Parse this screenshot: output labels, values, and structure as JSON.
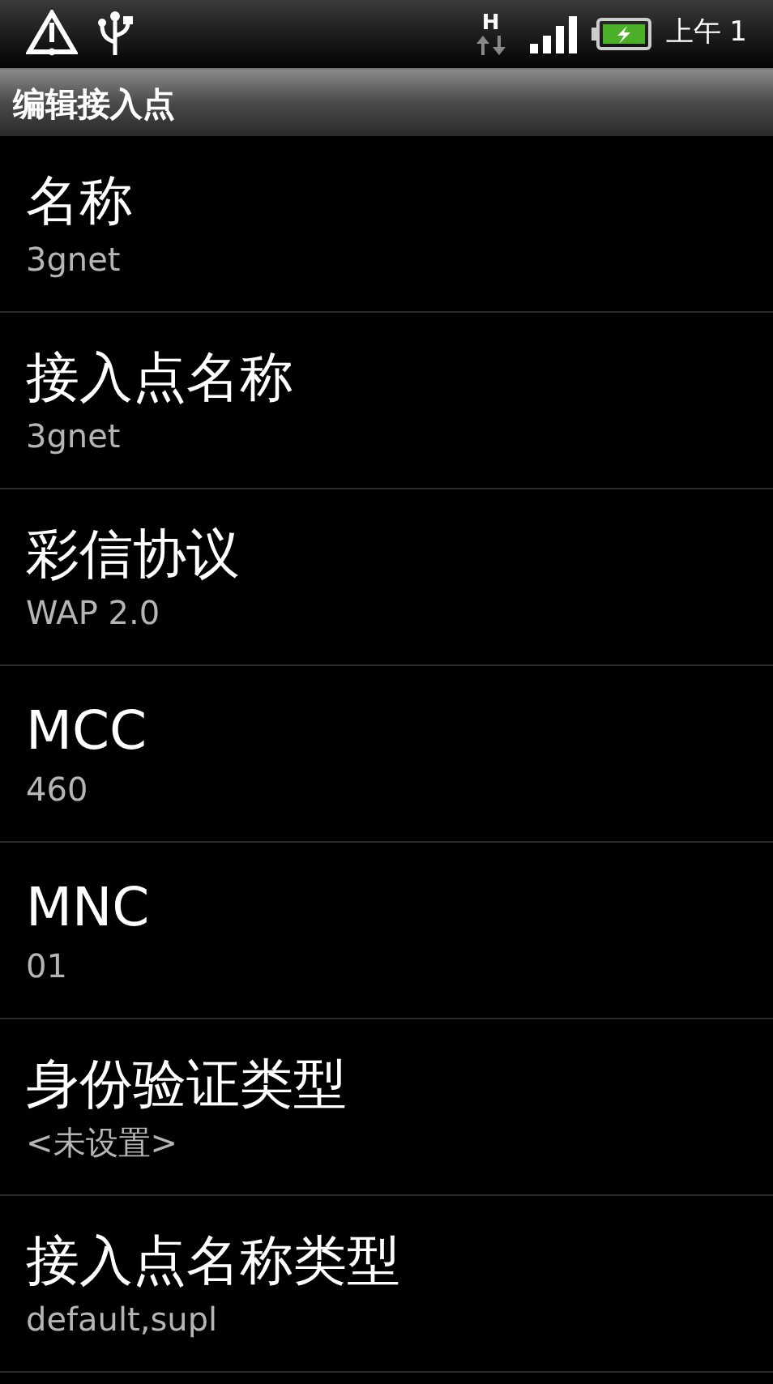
{
  "status_bar": {
    "network": "H",
    "time": "上午 1"
  },
  "title": "编辑接入点",
  "items": [
    {
      "label": "名称",
      "value": "3gnet"
    },
    {
      "label": "接入点名称",
      "value": "3gnet"
    },
    {
      "label": "彩信协议",
      "value": "WAP 2.0"
    },
    {
      "label": "MCC",
      "value": "460"
    },
    {
      "label": "MNC",
      "value": "01"
    },
    {
      "label": "身份验证类型",
      "value": "<未设置>"
    },
    {
      "label": "接入点名称类型",
      "value": "default,supl"
    }
  ]
}
